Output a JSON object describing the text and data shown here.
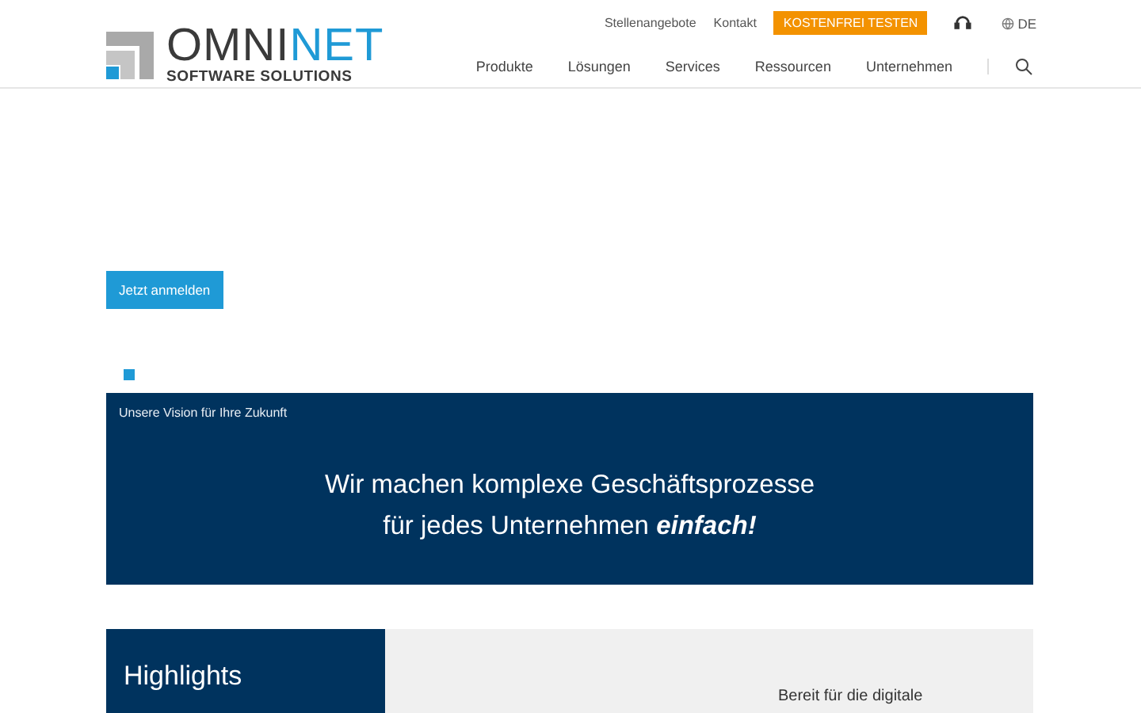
{
  "logo": {
    "word_dark": "OMNI",
    "word_accent": "NET",
    "tagline": "SOFTWARE SOLUTIONS"
  },
  "top_links": [
    "Stellenangebote",
    "Kontakt"
  ],
  "trial_button": "KOSTENFREI TESTEN",
  "language": "DE",
  "nav": [
    "Produkte",
    "Lösungen",
    "Services",
    "Ressourcen",
    "Unternehmen"
  ],
  "hero": {
    "button": "Jetzt anmelden"
  },
  "vision": {
    "eyebrow": "Unsere Vision für Ihre Zukunft",
    "line_1": "Wir machen komplexe Geschäftsprozesse",
    "line_2": "für jedes Unternehmen **einfach!**"
  },
  "highlights": {
    "title": "Highlights",
    "teaser": "Bereit für die digitale"
  }
}
